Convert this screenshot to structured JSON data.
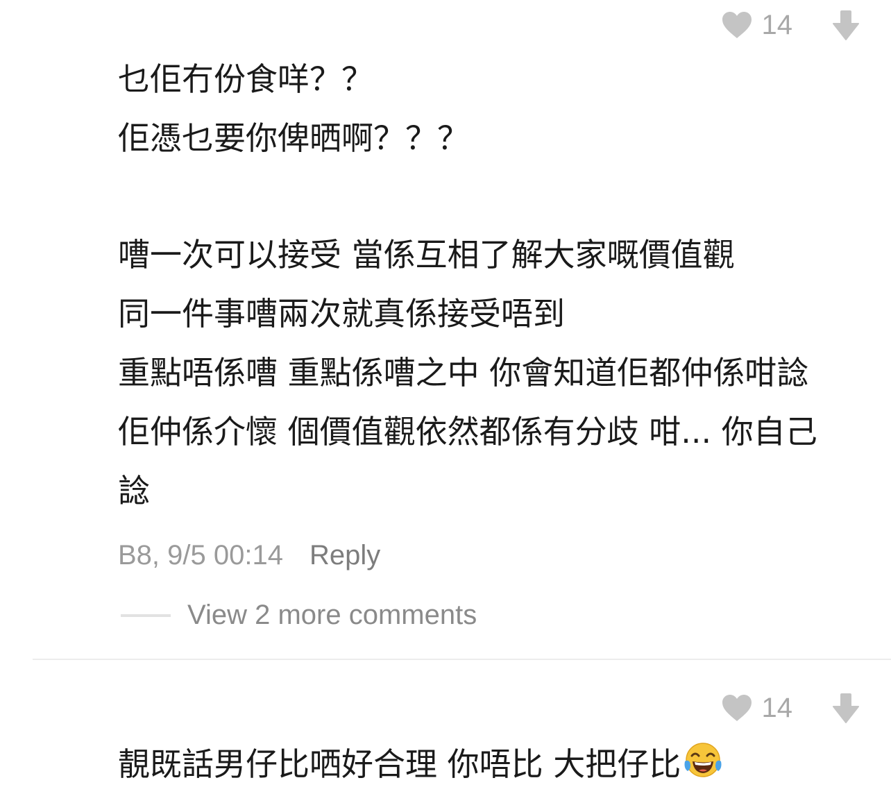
{
  "comment_1": {
    "like_count": "14",
    "lines": [
      "乜佢冇份食咩？？",
      "佢憑乜要你俾晒啊？？？",
      "",
      "嘈一次可以接受 當係互相了解大家嘅價值觀",
      "同一件事嘈兩次就真係接受唔到",
      "重點唔係嘈 重點係嘈之中 你會知道佢都仲係咁諗",
      "佢仲係介懷 個價值觀依然都係有分歧 咁... 你自己",
      "諗"
    ],
    "meta": "B8, 9/5 00:14",
    "reply_label": "Reply",
    "view_more_label": "View 2 more comments"
  },
  "comment_2": {
    "like_count": "14",
    "text": "靚既話男仔比哂好合理 你唔比 大把仔比",
    "emoji": "face-with-tears-of-joy"
  },
  "colors": {
    "icon_gray": "#c4c4c4",
    "count_gray": "#a8a8a8",
    "meta_gray": "#9a9a9a",
    "text": "#1a1a1a"
  }
}
